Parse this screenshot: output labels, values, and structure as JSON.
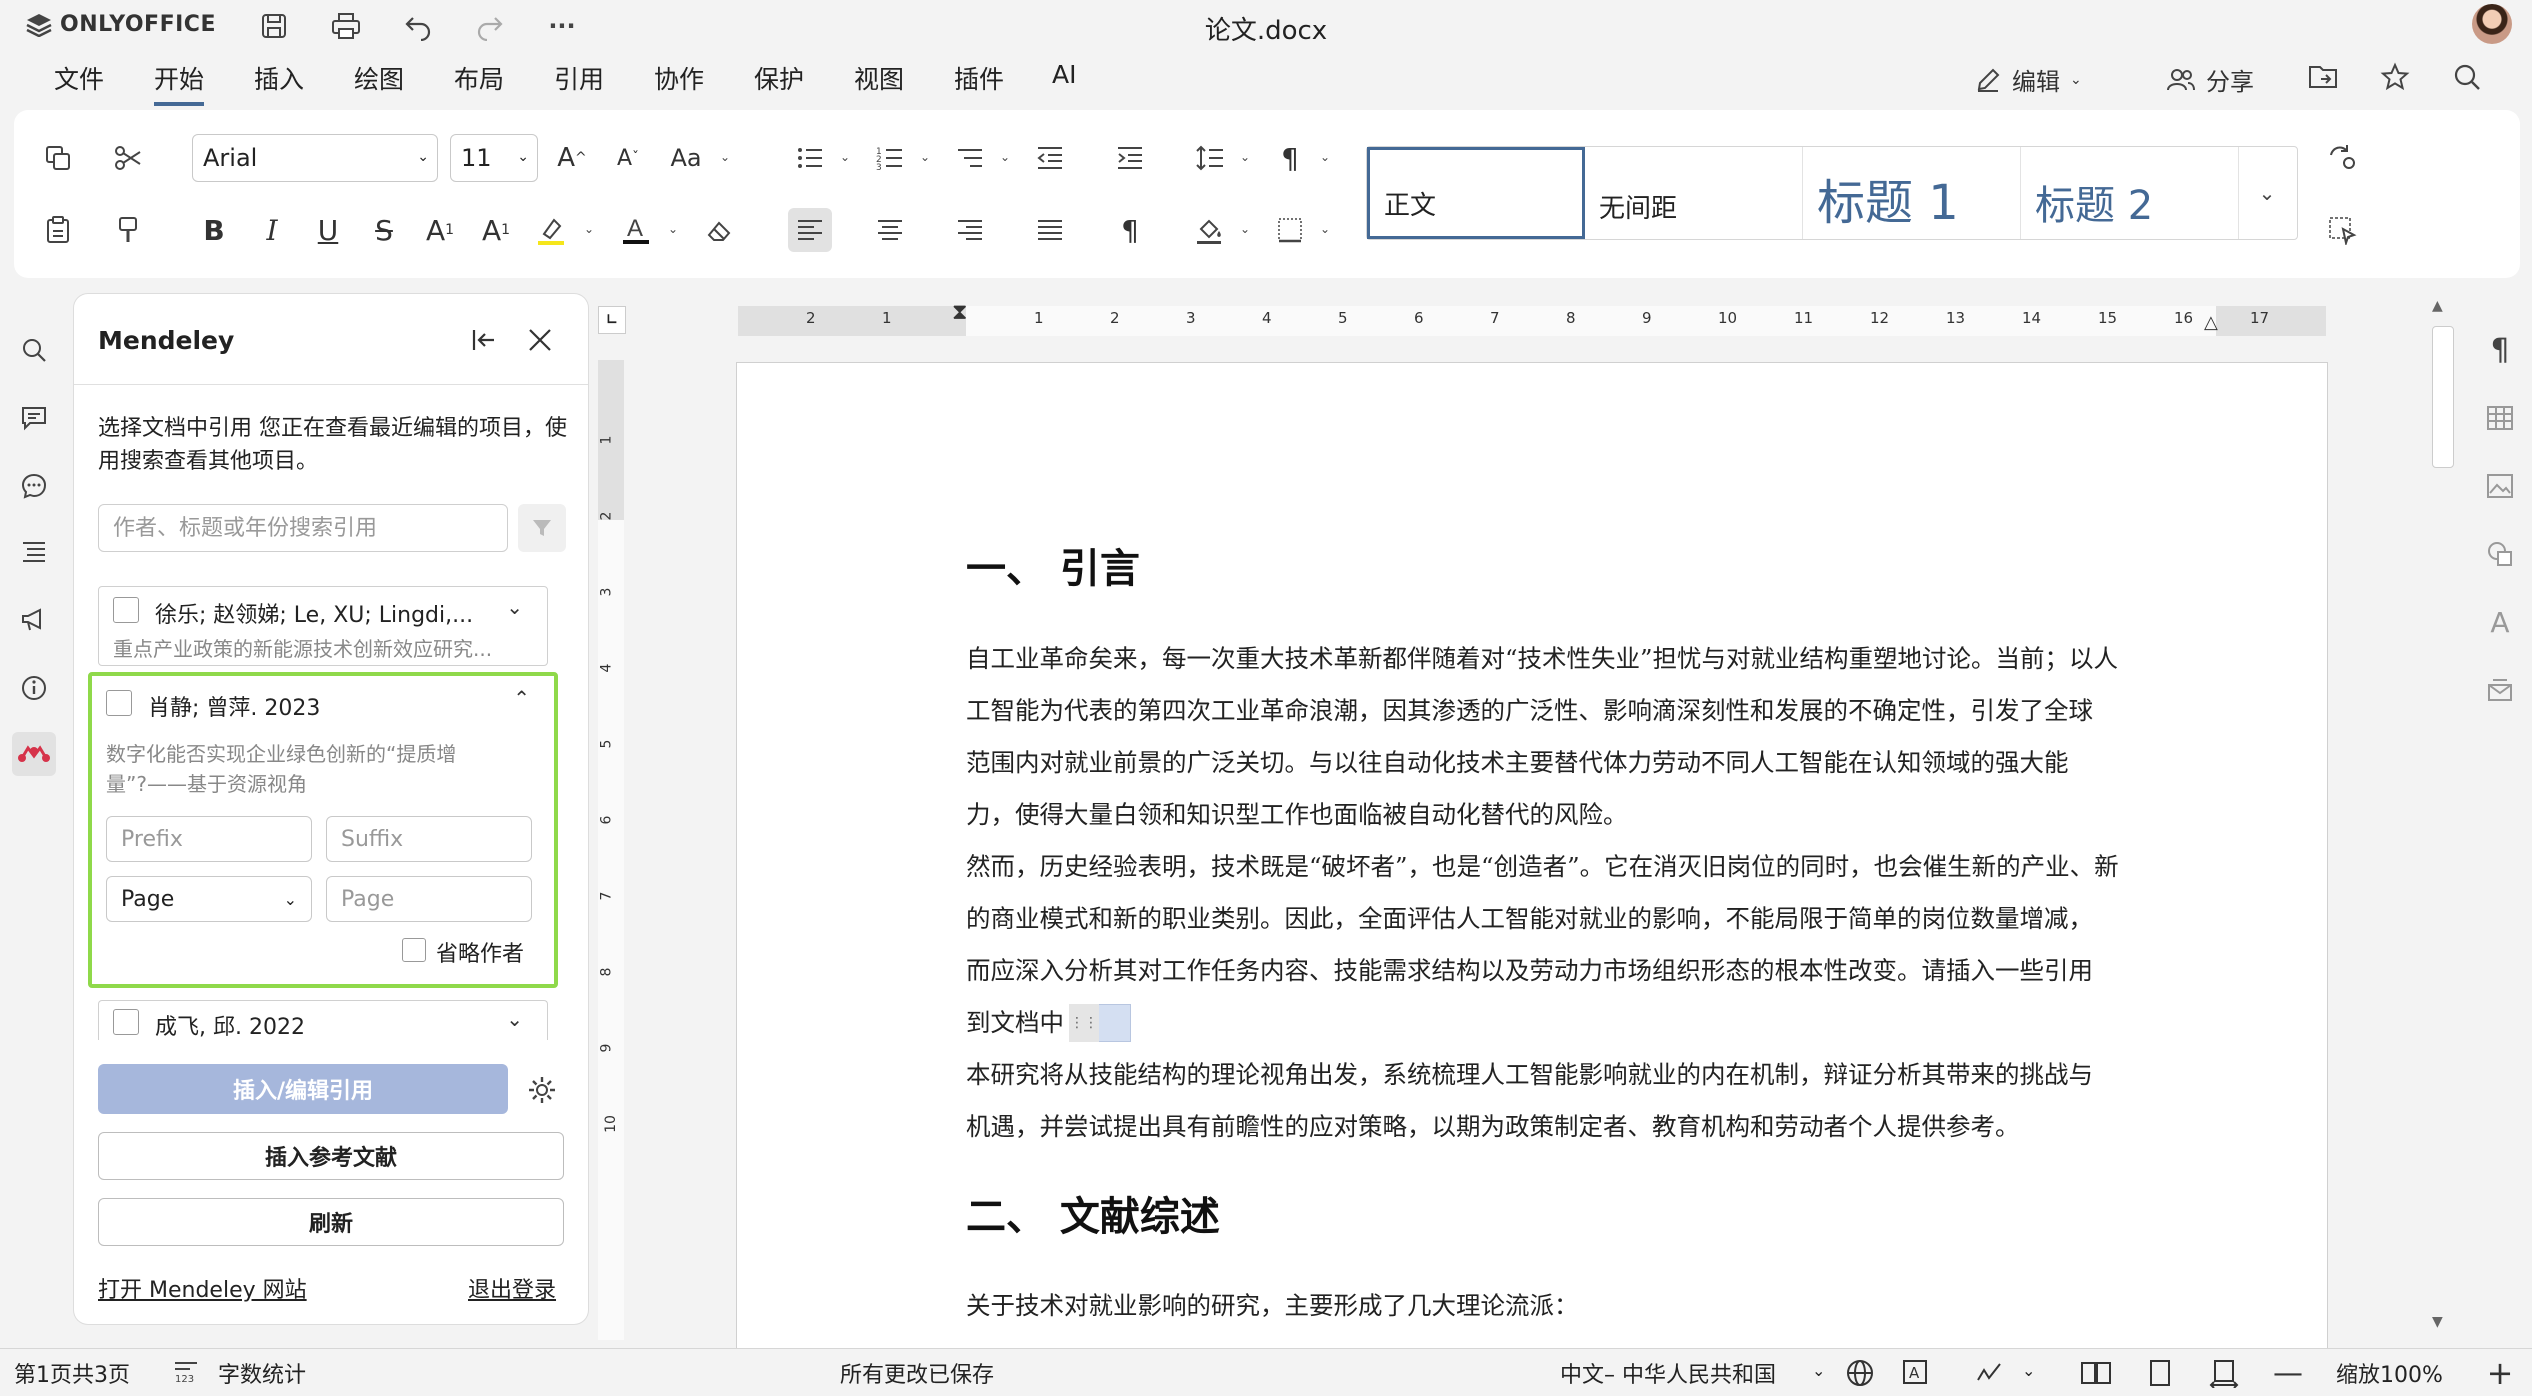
{
  "app": {
    "name": "ONLYOFFICE",
    "doc_title": "论文.docx"
  },
  "menu": [
    "文件",
    "开始",
    "插入",
    "绘图",
    "布局",
    "引用",
    "协作",
    "保护",
    "视图",
    "插件",
    "AI"
  ],
  "menu_active": "开始",
  "topright": {
    "edit_label": "编辑",
    "share_label": "分享"
  },
  "ribbon": {
    "font_name": "Arial",
    "font_size": "11",
    "styles": [
      "正文",
      "无间距",
      "标题 1",
      "标题 2"
    ],
    "accent": "#446995"
  },
  "mendeley": {
    "title": "Mendeley",
    "description": "选择文档中引用 您正在查看最近编辑的项目，使用搜索查看其他项目。",
    "search_placeholder": "作者、标题或年份搜索引用",
    "citations": [
      {
        "authors": "徐乐; 赵领娣; Le, XU; Lingdi,...",
        "title": "重点产业政策的新能源技术创新效应研究..."
      },
      {
        "authors": "肖静; 曾萍. 2023",
        "title_line1": "数字化能否实现企业绿色创新的“提质增",
        "title_line2": "量”?——基于资源视角",
        "prefix_placeholder": "Prefix",
        "suffix_placeholder": "Suffix",
        "locator": "Page",
        "locator_placeholder": "Page",
        "omit_author": "省略作者"
      },
      {
        "authors": "成飞, 邱. 2022"
      }
    ],
    "insert_edit_btn": "插入/编辑引用",
    "insert_bib_btn": "插入参考文献",
    "refresh_btn": "刷新",
    "open_site": "打开 Mendeley 网站",
    "logout": "退出登录"
  },
  "ruler": {
    "h_ticks": [
      "2",
      "1",
      "1",
      "2",
      "3",
      "4",
      "5",
      "6",
      "7",
      "8",
      "9",
      "10",
      "11",
      "12",
      "13",
      "14",
      "15",
      "16",
      "17"
    ],
    "v_ticks": [
      "1",
      "2",
      "3",
      "4",
      "5",
      "6",
      "7",
      "8",
      "9",
      "10"
    ]
  },
  "document": {
    "heading1": "一、 引言",
    "para1_lines": [
      "自工业革命矣来，每一次重大技术革新都伴随着对“技术性失业”担忧与对就业结构重塑地讨论。当前；以人",
      "工智能为代表的第四次工业革命浪潮，因其渗透的广泛性、影响滴深刻性和发展的不确定性，引发了全球",
      "范围内对就业前景的广泛关切。与以往自动化技术主要替代体力劳动不同人工智能在认知领域的强大能",
      "力，使得大量白领和知识型工作也面临被自动化替代的风险。"
    ],
    "para2_lines": [
      "然而，历史经验表明，技术既是“破坏者”，也是“创造者”。它在消灭旧岗位的同时，也会催生新的产业、新",
      "的商业模式和新的职业类别。因此，全面评估人工智能对就业的影响，不能局限于简单的岗位数量增减，",
      "而应深入分析其对工作任务内容、技能需求结构以及劳动力市场组织形态的根本性改变。请插入一些引用",
      "到文档中"
    ],
    "para3_lines": [
      "本研究将从技能结构的理论视角出发，系统梳理人工智能影响就业的内在机制，辩证分析其带来的挑战与",
      "机遇，并尝试提出具有前瞻性的应对策略，以期为政策制定者、教育机构和劳动者个人提供参考。"
    ],
    "heading2": "二、 文献综述",
    "para4": "关于技术对就业影响的研究，主要形成了几大理论流派："
  },
  "status": {
    "page": "第1页共3页",
    "word_count": "字数统计",
    "saved": "所有更改已保存",
    "language": "中文– 中华人民共和国",
    "zoom": "缩放100%"
  }
}
